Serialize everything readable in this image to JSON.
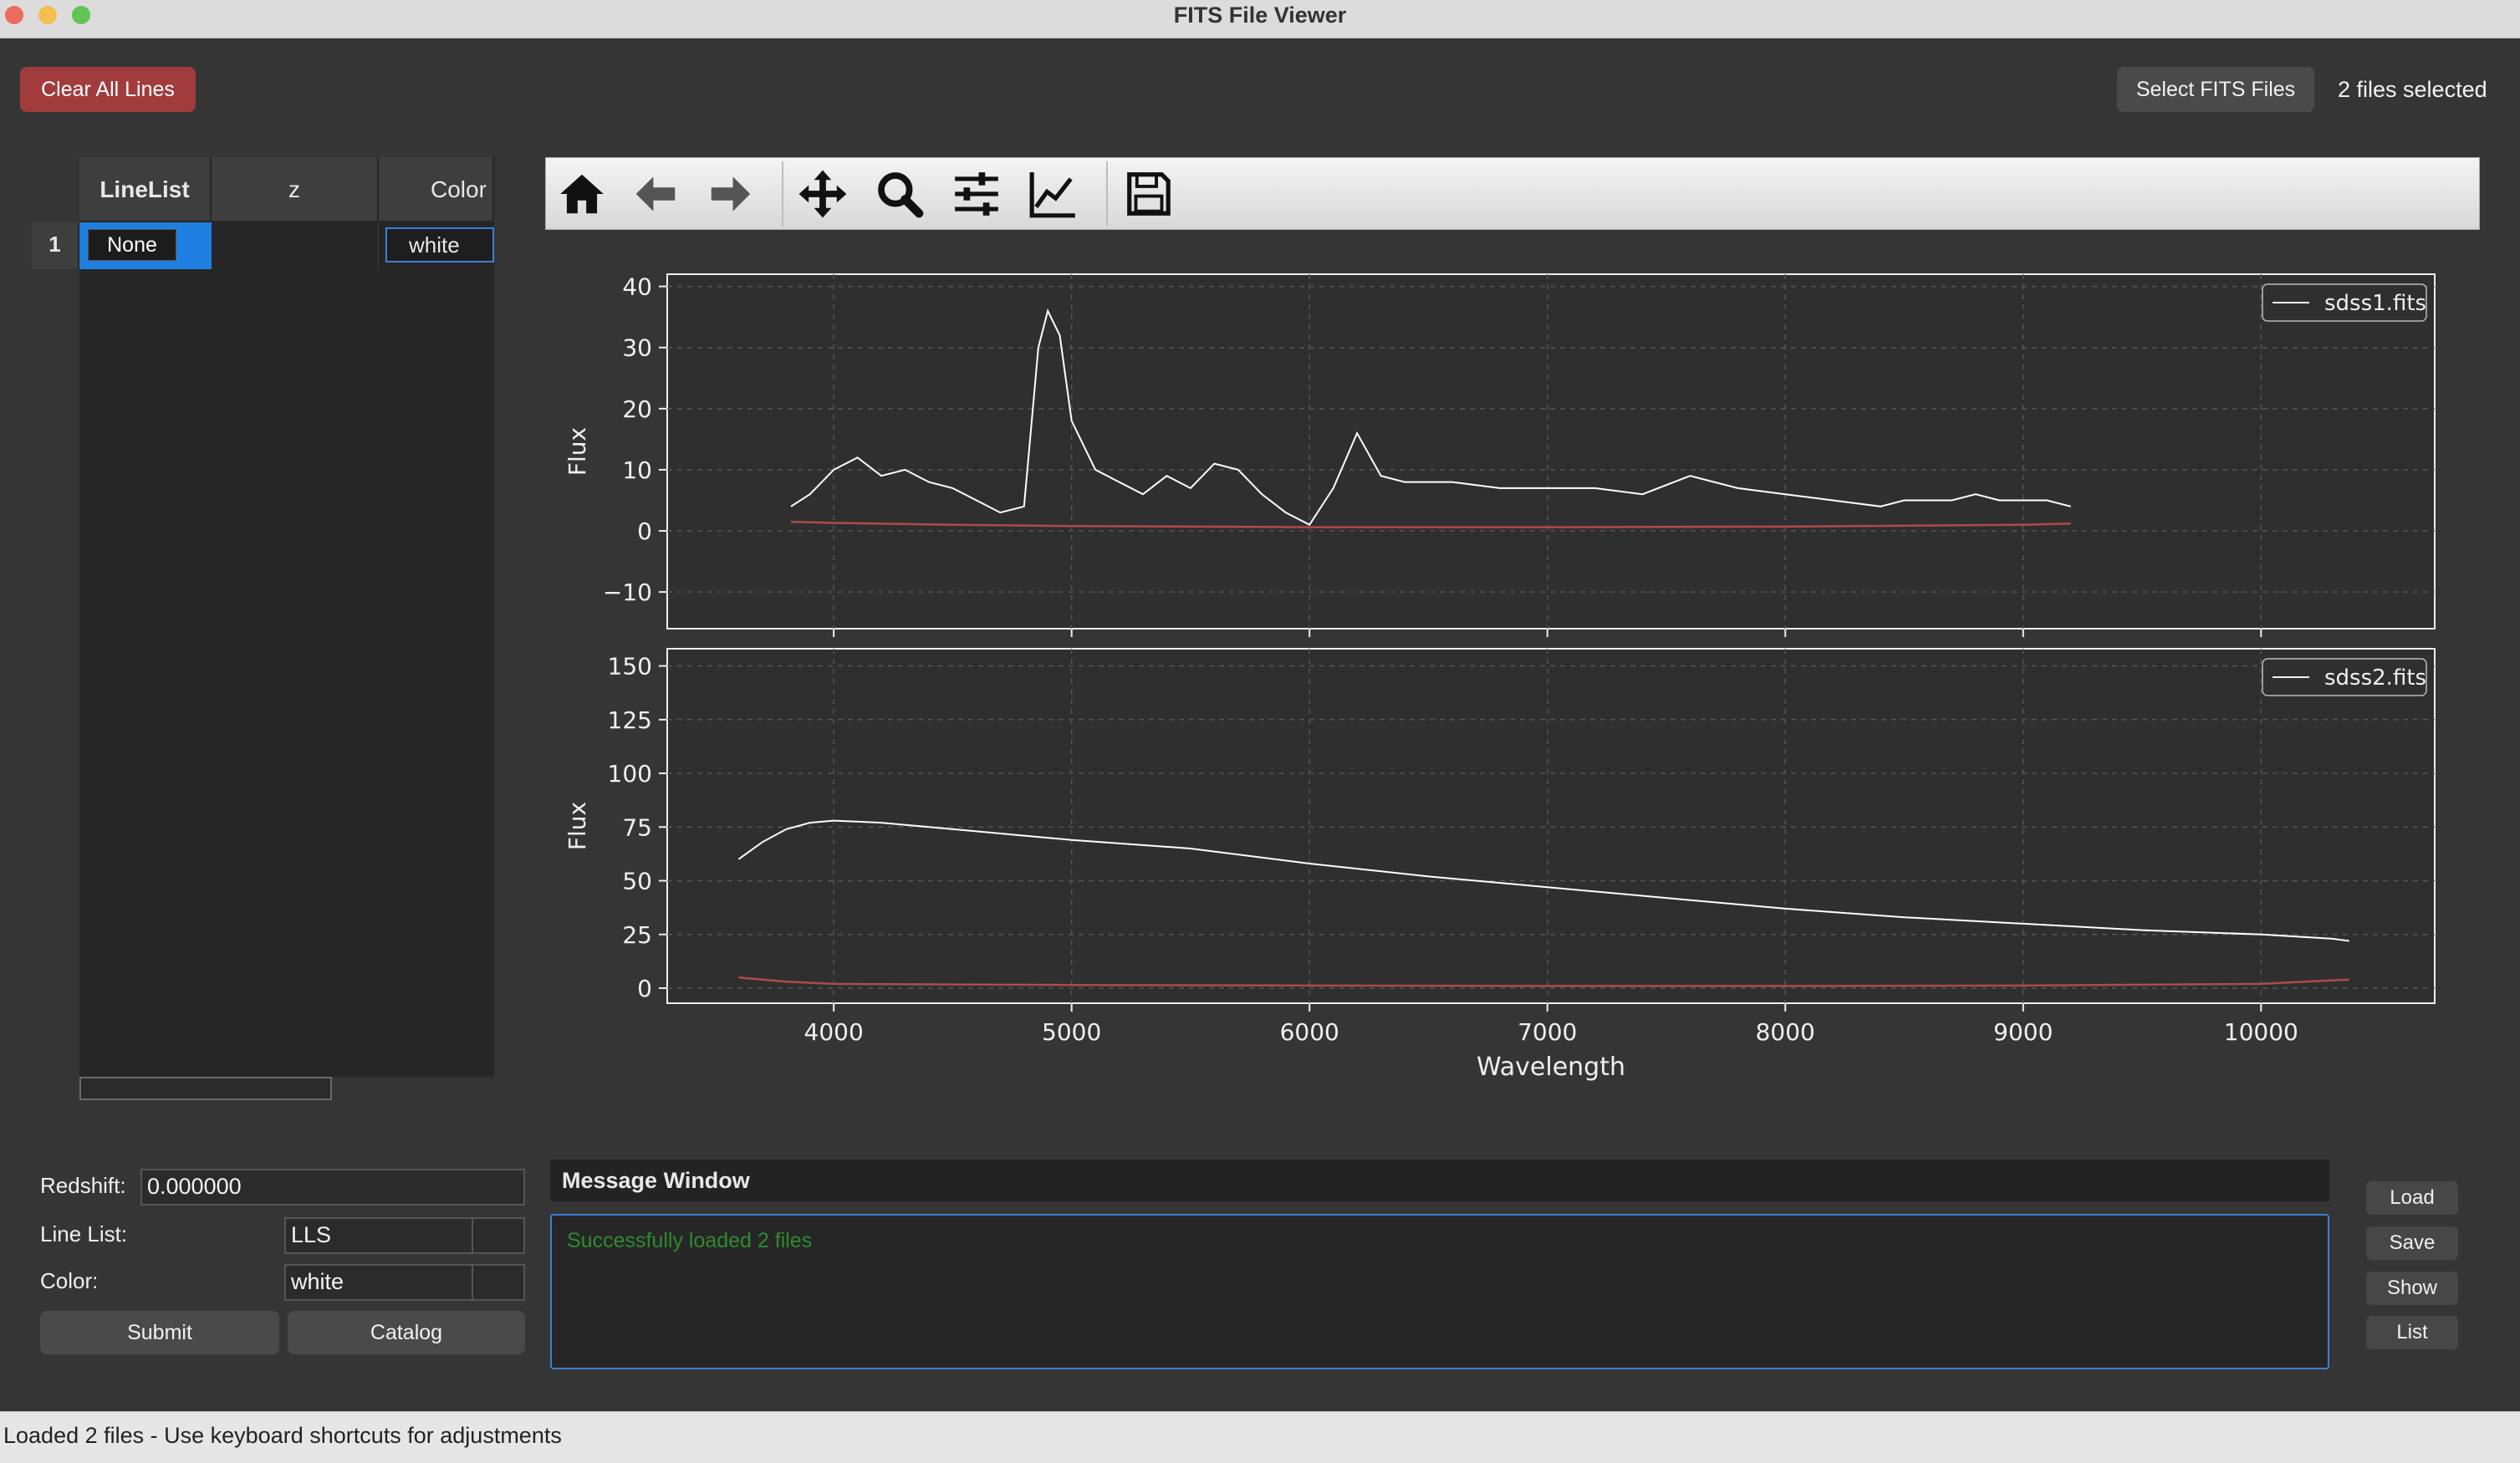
{
  "window": {
    "title": "FITS File Viewer"
  },
  "top": {
    "clear_all_lines": "Clear All Lines",
    "select_fits_files": "Select FITS Files",
    "files_selected": "2 files selected"
  },
  "table": {
    "headers": [
      "LineList",
      "z",
      "Color"
    ],
    "rows": [
      {
        "index": "1",
        "linelist": "None",
        "z": "",
        "color": "white"
      }
    ]
  },
  "toolbar": {
    "icons": [
      "home-icon",
      "back-arrow-icon",
      "forward-arrow-icon",
      "pan-move-icon",
      "zoom-magnifier-icon",
      "configure-subplots-icon",
      "edit-axis-icon",
      "save-floppy-icon"
    ]
  },
  "chart_data": [
    {
      "type": "line",
      "title": "",
      "xlabel": "",
      "ylabel": "Flux",
      "xlim": [
        3300,
        10730
      ],
      "ylim": [
        -16,
        42
      ],
      "yticks": [
        -10,
        0,
        10,
        20,
        30,
        40
      ],
      "ytick_labels": [
        "−10",
        "0",
        "10",
        "20",
        "30",
        "40"
      ],
      "grid": true,
      "legend": {
        "placement": "top-right",
        "entries": [
          "sdss1.fits"
        ]
      },
      "series": [
        {
          "name": "sdss1.fits",
          "color": "#ffffff",
          "x": [
            3820,
            3900,
            4000,
            4100,
            4200,
            4300,
            4400,
            4500,
            4600,
            4700,
            4800,
            4860,
            4900,
            4950,
            5000,
            5100,
            5200,
            5300,
            5400,
            5500,
            5600,
            5700,
            5800,
            5900,
            6000,
            6100,
            6200,
            6300,
            6400,
            6600,
            6800,
            7000,
            7200,
            7400,
            7600,
            7800,
            8000,
            8200,
            8400,
            8500,
            8600,
            8700,
            8800,
            8900,
            9000,
            9100,
            9200
          ],
          "y": [
            4,
            6,
            10,
            12,
            9,
            10,
            8,
            7,
            5,
            3,
            4,
            30,
            36,
            32,
            18,
            10,
            8,
            6,
            9,
            7,
            11,
            10,
            6,
            3,
            1,
            7,
            16,
            9,
            8,
            8,
            7,
            7,
            7,
            6,
            9,
            7,
            6,
            5,
            4,
            5,
            5,
            5,
            6,
            5,
            5,
            5,
            4
          ]
        },
        {
          "name": "",
          "color": "#b04a4a",
          "x": [
            3820,
            4000,
            4500,
            5000,
            6000,
            7000,
            8000,
            9000,
            9200
          ],
          "y": [
            1.5,
            1.3,
            1.0,
            0.8,
            0.6,
            0.6,
            0.7,
            1.0,
            1.2
          ]
        }
      ]
    },
    {
      "type": "line",
      "title": "",
      "xlabel": "Wavelength",
      "ylabel": "Flux",
      "xlim": [
        3300,
        10730
      ],
      "ylim": [
        -7,
        158
      ],
      "yticks": [
        0,
        25,
        50,
        75,
        100,
        125,
        150
      ],
      "xticks": [
        4000,
        5000,
        6000,
        7000,
        8000,
        9000,
        10000
      ],
      "grid": true,
      "legend": {
        "placement": "top-right",
        "entries": [
          "sdss2.fits"
        ]
      },
      "series": [
        {
          "name": "sdss2.fits",
          "color": "#ffffff",
          "x": [
            3600,
            3700,
            3800,
            3900,
            4000,
            4200,
            4400,
            4600,
            4800,
            5000,
            5500,
            6000,
            6500,
            7000,
            7500,
            8000,
            8500,
            9000,
            9500,
            10000,
            10300,
            10370
          ],
          "y": [
            60,
            68,
            74,
            77,
            78,
            77,
            75,
            73,
            71,
            69,
            65,
            58,
            52,
            47,
            42,
            37,
            33,
            30,
            27,
            25,
            23,
            22
          ]
        },
        {
          "name": "",
          "color": "#b04a4a",
          "x": [
            3600,
            3800,
            4000,
            5000,
            6000,
            7000,
            8000,
            9000,
            10000,
            10370
          ],
          "y": [
            5,
            3,
            2,
            1.5,
            1.2,
            1,
            1,
            1.2,
            2,
            4
          ]
        }
      ]
    }
  ],
  "controls": {
    "redshift_label": "Redshift:",
    "redshift_value": "0.000000",
    "linelist_label": "Line List:",
    "linelist_value": "LLS",
    "color_label": "Color:",
    "color_value": "white",
    "submit": "Submit",
    "catalog": "Catalog"
  },
  "message": {
    "title": "Message Window",
    "text": "Successfully loaded 2 files",
    "text_color": "#2e8b2e"
  },
  "side_buttons": [
    "Load",
    "Save",
    "Show",
    "List"
  ],
  "status": "Loaded 2 files - Use keyboard shortcuts for adjustments"
}
